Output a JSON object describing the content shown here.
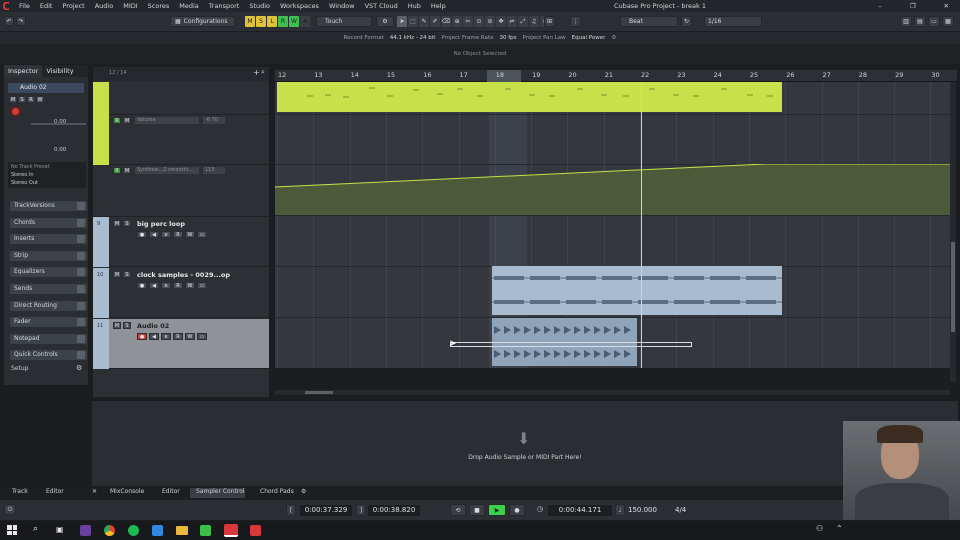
{
  "app": {
    "title": "Cubase Pro Project - break 1",
    "menu": [
      "File",
      "Edit",
      "Project",
      "Audio",
      "MIDI",
      "Scores",
      "Media",
      "Transport",
      "Studio",
      "Workspaces",
      "Window",
      "VST Cloud",
      "Hub",
      "Help"
    ]
  },
  "toolbar": {
    "configurations": "Configurations",
    "mode_letters": [
      "M",
      "S",
      "L",
      "R",
      "W",
      "A"
    ],
    "automation_mode": "Touch",
    "snap_type": "Beat",
    "quantize": "1/16"
  },
  "infobar": {
    "record_format_label": "Record Format",
    "record_format_value": "44.1 kHz - 24 bit",
    "frame_rate_label": "Project Frame Rate",
    "frame_rate_value": "30 fps",
    "pan_law_label": "Project Pan Law",
    "pan_law_value": "Equal Power"
  },
  "status": {
    "selection": "No Object Selected"
  },
  "inspector": {
    "tab_inspector": "Inspector",
    "tab_visibility": "Visibility",
    "track_name": "Audio 02",
    "volume_value": "0.00",
    "pan_value": "0.00",
    "preset": "No Track Preset",
    "input": "Stereo In",
    "output": "Stereo Out",
    "sections": [
      "TrackVersions",
      "Chords",
      "Inserts",
      "Strip",
      "Equalizers",
      "Sends",
      "Direct Routing",
      "Fader",
      "Notepad",
      "Quick Controls"
    ],
    "setup": "Setup"
  },
  "tracklist": {
    "counter": "12 / 14",
    "automation_volume": "Volume",
    "automation_volume_value": "-6.70",
    "automation_param": "Synthesi...2 smoothi...",
    "automation_param_value": "113",
    "tracks": [
      {
        "num": "9",
        "name": "big perc loop"
      },
      {
        "num": "10",
        "name": "clock samples - 0029...op"
      },
      {
        "num": "11",
        "name": "Audio 02"
      }
    ]
  },
  "ruler": {
    "bars": [
      "12",
      "13",
      "14",
      "15",
      "16",
      "17",
      "18",
      "19",
      "20",
      "21",
      "22",
      "23",
      "24",
      "25",
      "26",
      "27",
      "28",
      "29",
      "30"
    ]
  },
  "lower_zone": {
    "drop_hint": "Drop Audio Sample or MIDI Part Here!",
    "left_tabs": [
      "Track",
      "Editor"
    ],
    "tabs": [
      "MixConsole",
      "Editor",
      "Sampler Control",
      "Chord Pads"
    ]
  },
  "transport": {
    "left_locator": "0:00:37.329",
    "right_locator": "0:00:38.820",
    "position": "0:00:44.171",
    "tempo": "150.000",
    "signature": "4/4"
  },
  "colors": {
    "midi_part": "#c8e04a",
    "automation_fill": "#4d5a3a",
    "audio_event": "#a9bccf",
    "record_red": "#d33a3a",
    "play_green": "#3fcf4f"
  }
}
